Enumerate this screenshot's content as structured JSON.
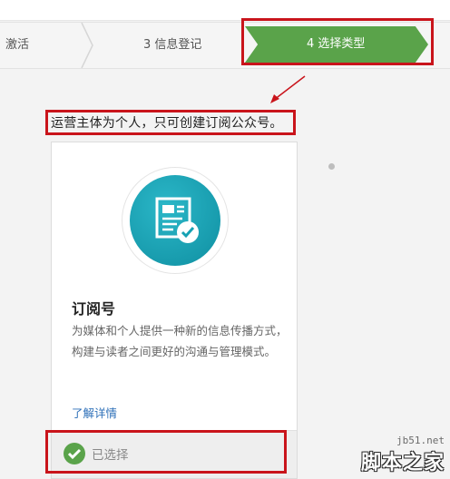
{
  "steps": [
    {
      "label": "激活"
    },
    {
      "label": "3 信息登记"
    },
    {
      "label": "4 选择类型",
      "active": true
    }
  ],
  "notice": "运营主体为个人，只可创建订阅公众号。",
  "card": {
    "icon": "subscription-document-check-icon",
    "title": "订阅号",
    "description": "为媒体和个人提供一种新的信息传播方式，构建与读者之间更好的沟通与管理模式。",
    "link": "了解详情",
    "selected": "已选择"
  },
  "watermark": {
    "url": "jb51.net",
    "name": "脚本之家"
  },
  "colors": {
    "active_step": "#5aa34a",
    "highlight": "#c9141b",
    "icon_bg": "#16a1b3",
    "link": "#2d6fb8"
  }
}
